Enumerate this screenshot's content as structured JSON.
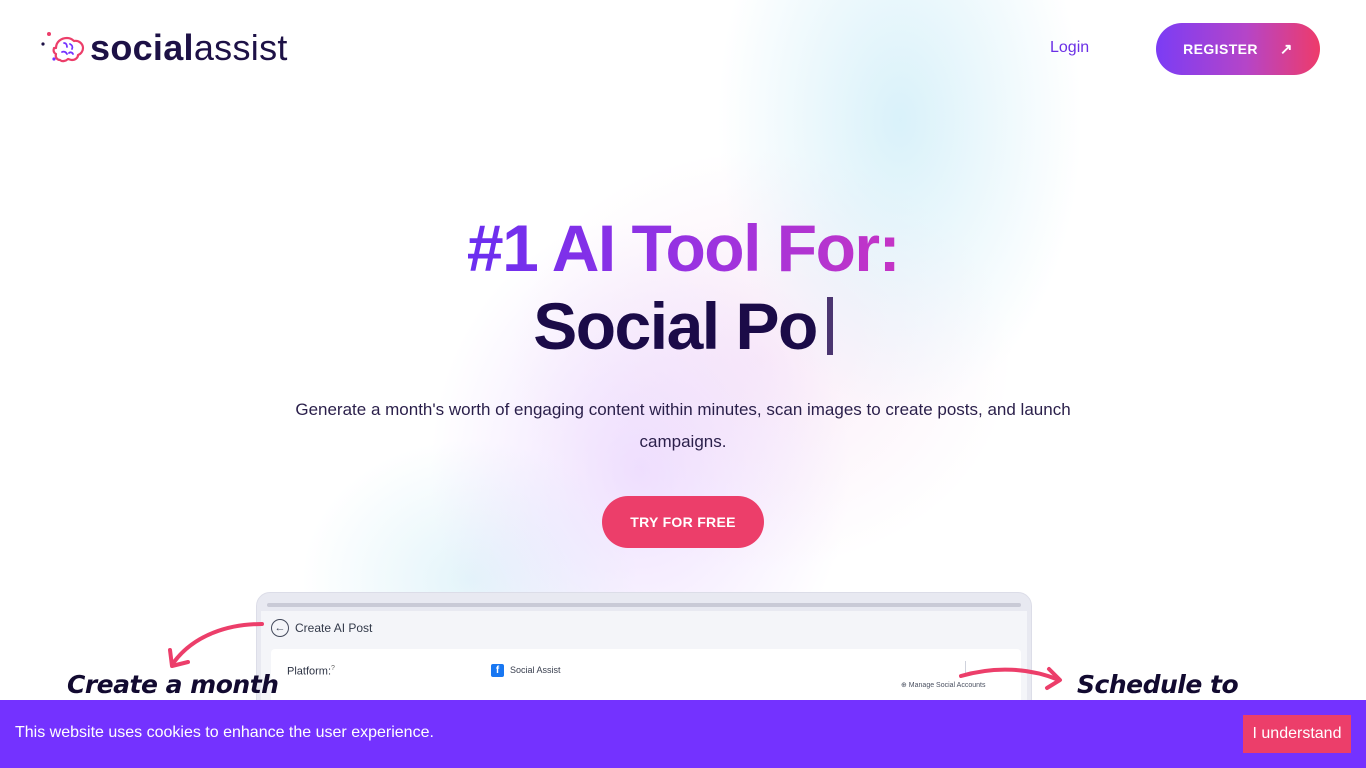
{
  "brand": {
    "name_bold": "social",
    "name_light": "assist",
    "colors": {
      "dark": "#1d1146",
      "accent_pink": "#ec3e6a",
      "accent_purple": "#7432ff"
    }
  },
  "nav": {
    "login_label": "Login",
    "register_label": "REGISTER",
    "register_icon": "arrow-up-right-icon"
  },
  "hero": {
    "headline": "#1 AI Tool For:",
    "typed_text": "Social Po",
    "subtitle": "Generate a month's worth of engaging content within minutes, scan images to create posts, and launch campaigns.",
    "cta_label": "TRY FOR FREE"
  },
  "preview": {
    "back_icon": "back-arrow-icon",
    "title": "Create AI Post",
    "platform_label": "Platform:",
    "platform_hint_glyph": "?",
    "account_icon": "facebook-icon",
    "account_name": "Social Assist",
    "manage_link": "⊕ Manage Social Accounts"
  },
  "annotations": {
    "left": "Create a month",
    "right": "Schedule to Facebook"
  },
  "cookie": {
    "message": "This website uses cookies to enhance the user experience.",
    "button_label": "I understand"
  }
}
